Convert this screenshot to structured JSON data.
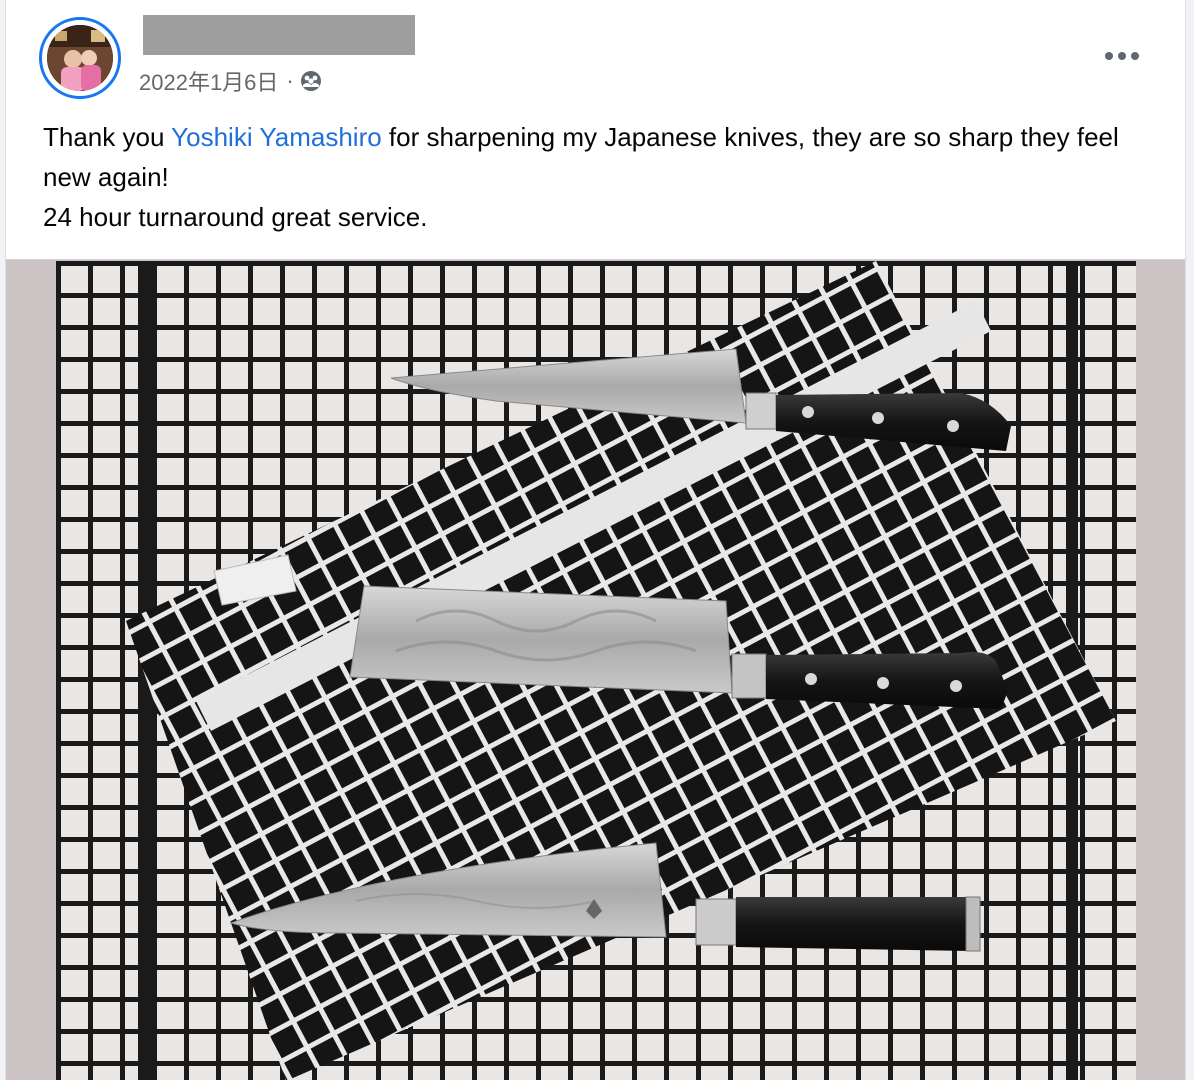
{
  "post": {
    "author_name": "",
    "date": "2022年1月6日",
    "separator": "·",
    "audience_icon": "friends-icon",
    "more_icon": "more-options-icon",
    "text": {
      "part1": "Thank you ",
      "mention": "Yoshiki Yamashiro",
      "part2": " for sharpening my Japanese knives, they are so sharp they feel new again!",
      "line2": "24 hour turnaround  great service."
    }
  },
  "photo": {
    "subject": "three-knives-on-checkered-towel",
    "knives": [
      "petty-knife",
      "nakiri-knife",
      "chef-knife"
    ],
    "colors": {
      "towel_white": "#e9e6e4",
      "towel_black": "#151515",
      "blade": "#b8b8b8",
      "handle": "#1a1a1a",
      "frame_bg": "#ccc4c4",
      "mention_link": "#216fdb",
      "avatar_ring": "#1877f2"
    }
  }
}
